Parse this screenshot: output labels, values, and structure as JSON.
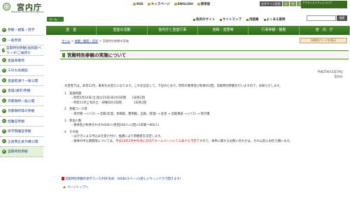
{
  "header": {
    "site_title": "宮内庁",
    "site_subtitle": "Imperial Household Agency",
    "home_label": "ホーム",
    "top_links": [
      "RSS",
      "キッズページ",
      "ENGLISH",
      "携帯版"
    ],
    "text_size_label": "文字サイズ変更",
    "text_sizes": [
      "小",
      "中",
      "大"
    ],
    "accessibility_label": "アクセシビリティについて",
    "sub_links": [
      "政府のサイト",
      "サイトマップ",
      "用語集",
      "よくある質問"
    ],
    "search_button": "検索"
  },
  "gnav": [
    "皇　室",
    "皇室の活動",
    "宮内庁と皇室行事",
    "宮殿・皇居等",
    "行事参観・観覧",
    "宮　内　庁"
  ],
  "sidebar": [
    "参観・観覧・見学",
    "一般参賀",
    "宮殿特別参観(長和殿ベランダ(ご挨拶))",
    "皇居東御苑",
    "三の丸尚蔵館",
    "皇居乾通り一般公開",
    "皇居(通年)参観",
    "京都御所一般公開",
    "京都御所等の参観",
    "桂離宮参観",
    "修学院離宮参観",
    "正倉院正倉外構公開",
    "宮殿特別参観"
  ],
  "breadcrumb": [
    "ホーム",
    "参観・観覧・見学",
    "宮殿特別参観の実施"
  ],
  "print_label": "印刷用ページを表示",
  "page_title": "宮殿特別参観の実施について",
  "date": "平成25年12月19日",
  "dept": "宮内庁",
  "intro": "天皇陛下は，本年12月，傘寿をお迎えになります。これを記念して，下記のとおり，明年の春季及び秋季の2回，宮殿特別参観を行いますので，お知らせします。",
  "items": [
    {
      "num": "1",
      "head": "実施時期",
      "lines": [
        "・明年5月24日(土)及び25日(日)の2日間　　1日各2回",
        "・明年11月上旬の土・日曜日の2日間　　　　1日各2回"
      ]
    },
    {
      "num": "2",
      "head": "参観コース等",
      "lines": [
        "・受付場 → (バス) → 宮殿(北溜，長和殿，豊明殿，正殿，南溜) → 徒歩 → 宮殿東庭 → (バス) → 受付場"
      ]
    },
    {
      "num": "3",
      "head": "参加人数",
      "lines": [
        "・春季及び秋季それぞれ400人(各回200人×2回×2日間＝800人)"
      ]
    },
    {
      "num": "4",
      "head": "その他",
      "lines": [
        "・はがきによる申込みを受け付け，抽選により参観者を決定します。",
        "・春季の申込期間等については，平成26年2月中旬頃に宮内庁ホームページにて公表する予定ですので，本件に関するお問い合わせは，それ以前にお控え願います。"
      ]
    }
  ],
  "note_red": "平成26年2月中旬頃に宮内庁ホームページにて公表する予定",
  "pdf_link": "宮殿特別参観の見学コース(PDF形式：44KB)(1ページ)(新しいウィンドウで開きます)",
  "page_top": "ページトップへ",
  "colors": {
    "brand_green": "#3b7a24",
    "link_blue": "#1a3d8a",
    "red": "#d21a1a"
  }
}
